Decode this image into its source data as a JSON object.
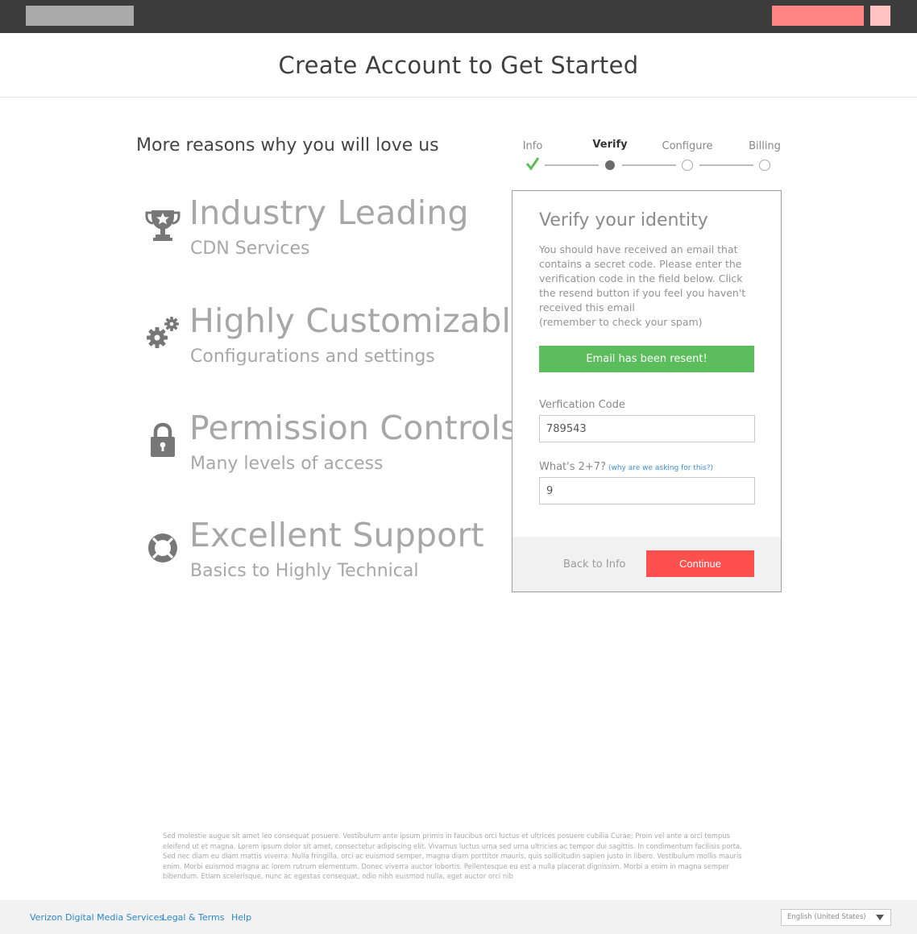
{
  "colors": {
    "topbar": "#3c3c3c",
    "accent_red": "#ff5050",
    "success_green": "#5cbd5c",
    "link_blue": "#2f86c4",
    "feature_gray": "#a7a7a7"
  },
  "header": {
    "title": "Create Account to Get Started"
  },
  "reasons": {
    "title": "More reasons why you will love us",
    "features": [
      {
        "icon": "trophy-icon",
        "title": "Industry Leading",
        "subtitle": "CDN Services"
      },
      {
        "icon": "gears-icon",
        "title": "Highly Customizable",
        "subtitle": "Configurations and settings"
      },
      {
        "icon": "lock-icon",
        "title": "Permission Controls",
        "subtitle": "Many levels of access"
      },
      {
        "icon": "lifebuoy-icon",
        "title": "Excellent Support",
        "subtitle": "Basics to Highly Technical"
      }
    ]
  },
  "stepper": {
    "steps": [
      {
        "label": "Info",
        "state": "complete"
      },
      {
        "label": "Verify",
        "state": "current"
      },
      {
        "label": "Configure",
        "state": "upcoming"
      },
      {
        "label": "Billing",
        "state": "upcoming"
      }
    ]
  },
  "verify": {
    "title": "Verify your identity",
    "description_lines": [
      "You should have received an email that",
      "contains a secret code. Please enter the",
      "verification code in the field below. Click",
      "the resend button if you feel you haven't",
      "received this email",
      "(remember to check your spam)"
    ],
    "alert": "Email has been resent!",
    "code_label": "Verfication Code",
    "code_value": "789543",
    "captcha_label": "What's 2+7?",
    "captcha_why": "(why are we asking for this?)",
    "captcha_value": "9",
    "back_label": "Back to Info",
    "continue_label": "Continue"
  },
  "legal_text": "Sed molestie augue sit amet leo consequat posuere. Vestibulum ante ipsum primis in faucibus orci luctus et ultrices posuere cubilia Curae; Proin vel ante a orci tempus eleifend ut et magna. Lorem ipsum dolor sit amet, consectetur adipiscing elit. Vivamus luctus urna sed urna ultricies ac tempor dui sagittis. In condimentum facilisis porta. Sed nec diam eu diam mattis viverra. Nulla fringilla, orci ac euismod semper, magna diam porttitor mauris, quis sollicitudin sapien justo in libero. Vestibulum mollis mauris enim. Morbi euismod magna ac lorem rutrum elementum. Donec viverra auctor lobortis. Pellentesque eu est a nulla placerat dignissim. Morbi a enim in magna semper bibendum. Etiam scelerisque, nunc ac egestas consequat, odio nibh euismod nulla, eget auctor orci nib",
  "footer": {
    "links": [
      "Verizon Digital Media Services",
      "Legal & Terms",
      "Help"
    ],
    "language": "English (United States)"
  }
}
